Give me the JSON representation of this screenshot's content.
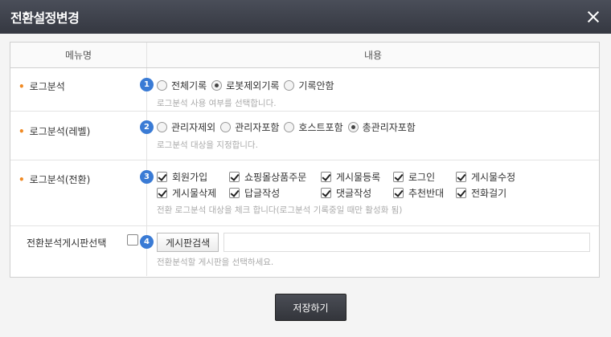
{
  "dialog": {
    "title": "전환설정변경"
  },
  "table": {
    "header_menu": "메뉴명",
    "header_content": "내용"
  },
  "rows": [
    {
      "label": "로그분석",
      "num": "1",
      "options": [
        "전체기록",
        "로봇제외기록",
        "기록안함"
      ],
      "hint": "로그분석 사용 여부를 선택합니다."
    },
    {
      "label": "로그분석(레벨)",
      "num": "2",
      "options": [
        "관리자제외",
        "관리자포함",
        "호스트포함",
        "총관리자포함"
      ],
      "hint": "로그분석 대상을 지정합니다."
    },
    {
      "label": "로그분석(전환)",
      "num": "3",
      "options": [
        "회원가입",
        "쇼핑몰상품주문",
        "게시물등록",
        "로그인",
        "게시물수정",
        "게시물삭제",
        "답글작성",
        "댓글작성",
        "추천반대",
        "전화걸기"
      ],
      "hint": "전환 로그분석 대상을 체크 합니다(로그분석 기록중일 때만 활성화 됨)"
    },
    {
      "label": "전환분석게시판선택",
      "num": "4",
      "button": "게시판검색",
      "hint": "전환분석할 게시판을 선택하세요."
    }
  ],
  "footer": {
    "save_label": "저장하기"
  }
}
